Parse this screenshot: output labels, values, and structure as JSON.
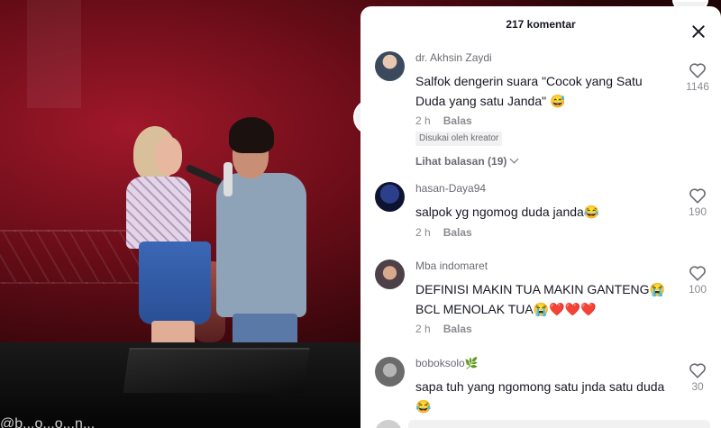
{
  "video": {
    "watermark": "@b...o...o...n..."
  },
  "panel": {
    "title": "217 komentar",
    "comments": [
      {
        "username": "dr. Akhsin Zaydi",
        "text": "Salfok dengerin suara \"Cocok yang Satu Duda yang satu Janda\" 😅",
        "time": "2 h",
        "reply_label": "Balas",
        "badge": "Disukai oleh kreator",
        "view_replies": "Lihat balasan (19)",
        "likes": "1146"
      },
      {
        "username": "hasan-Daya94",
        "text": "salpok yg ngomog duda janda😂",
        "time": "2 h",
        "reply_label": "Balas",
        "likes": "190"
      },
      {
        "username": "Mba indomaret",
        "text": "DEFINISI MAKIN TUA MAKIN GANTENG😭 BCL MENOLAK TUA😭❤️❤️❤️",
        "time": "2 h",
        "reply_label": "Balas",
        "likes": "100"
      },
      {
        "username": "boboksolo🌿",
        "text": "sapa tuh yang ngomong satu jnda satu duda 😂",
        "likes": "30"
      }
    ]
  },
  "colors": {
    "text_primary": "#161823",
    "text_secondary": "#8a8b91",
    "badge_bg": "#f1f1f2"
  }
}
